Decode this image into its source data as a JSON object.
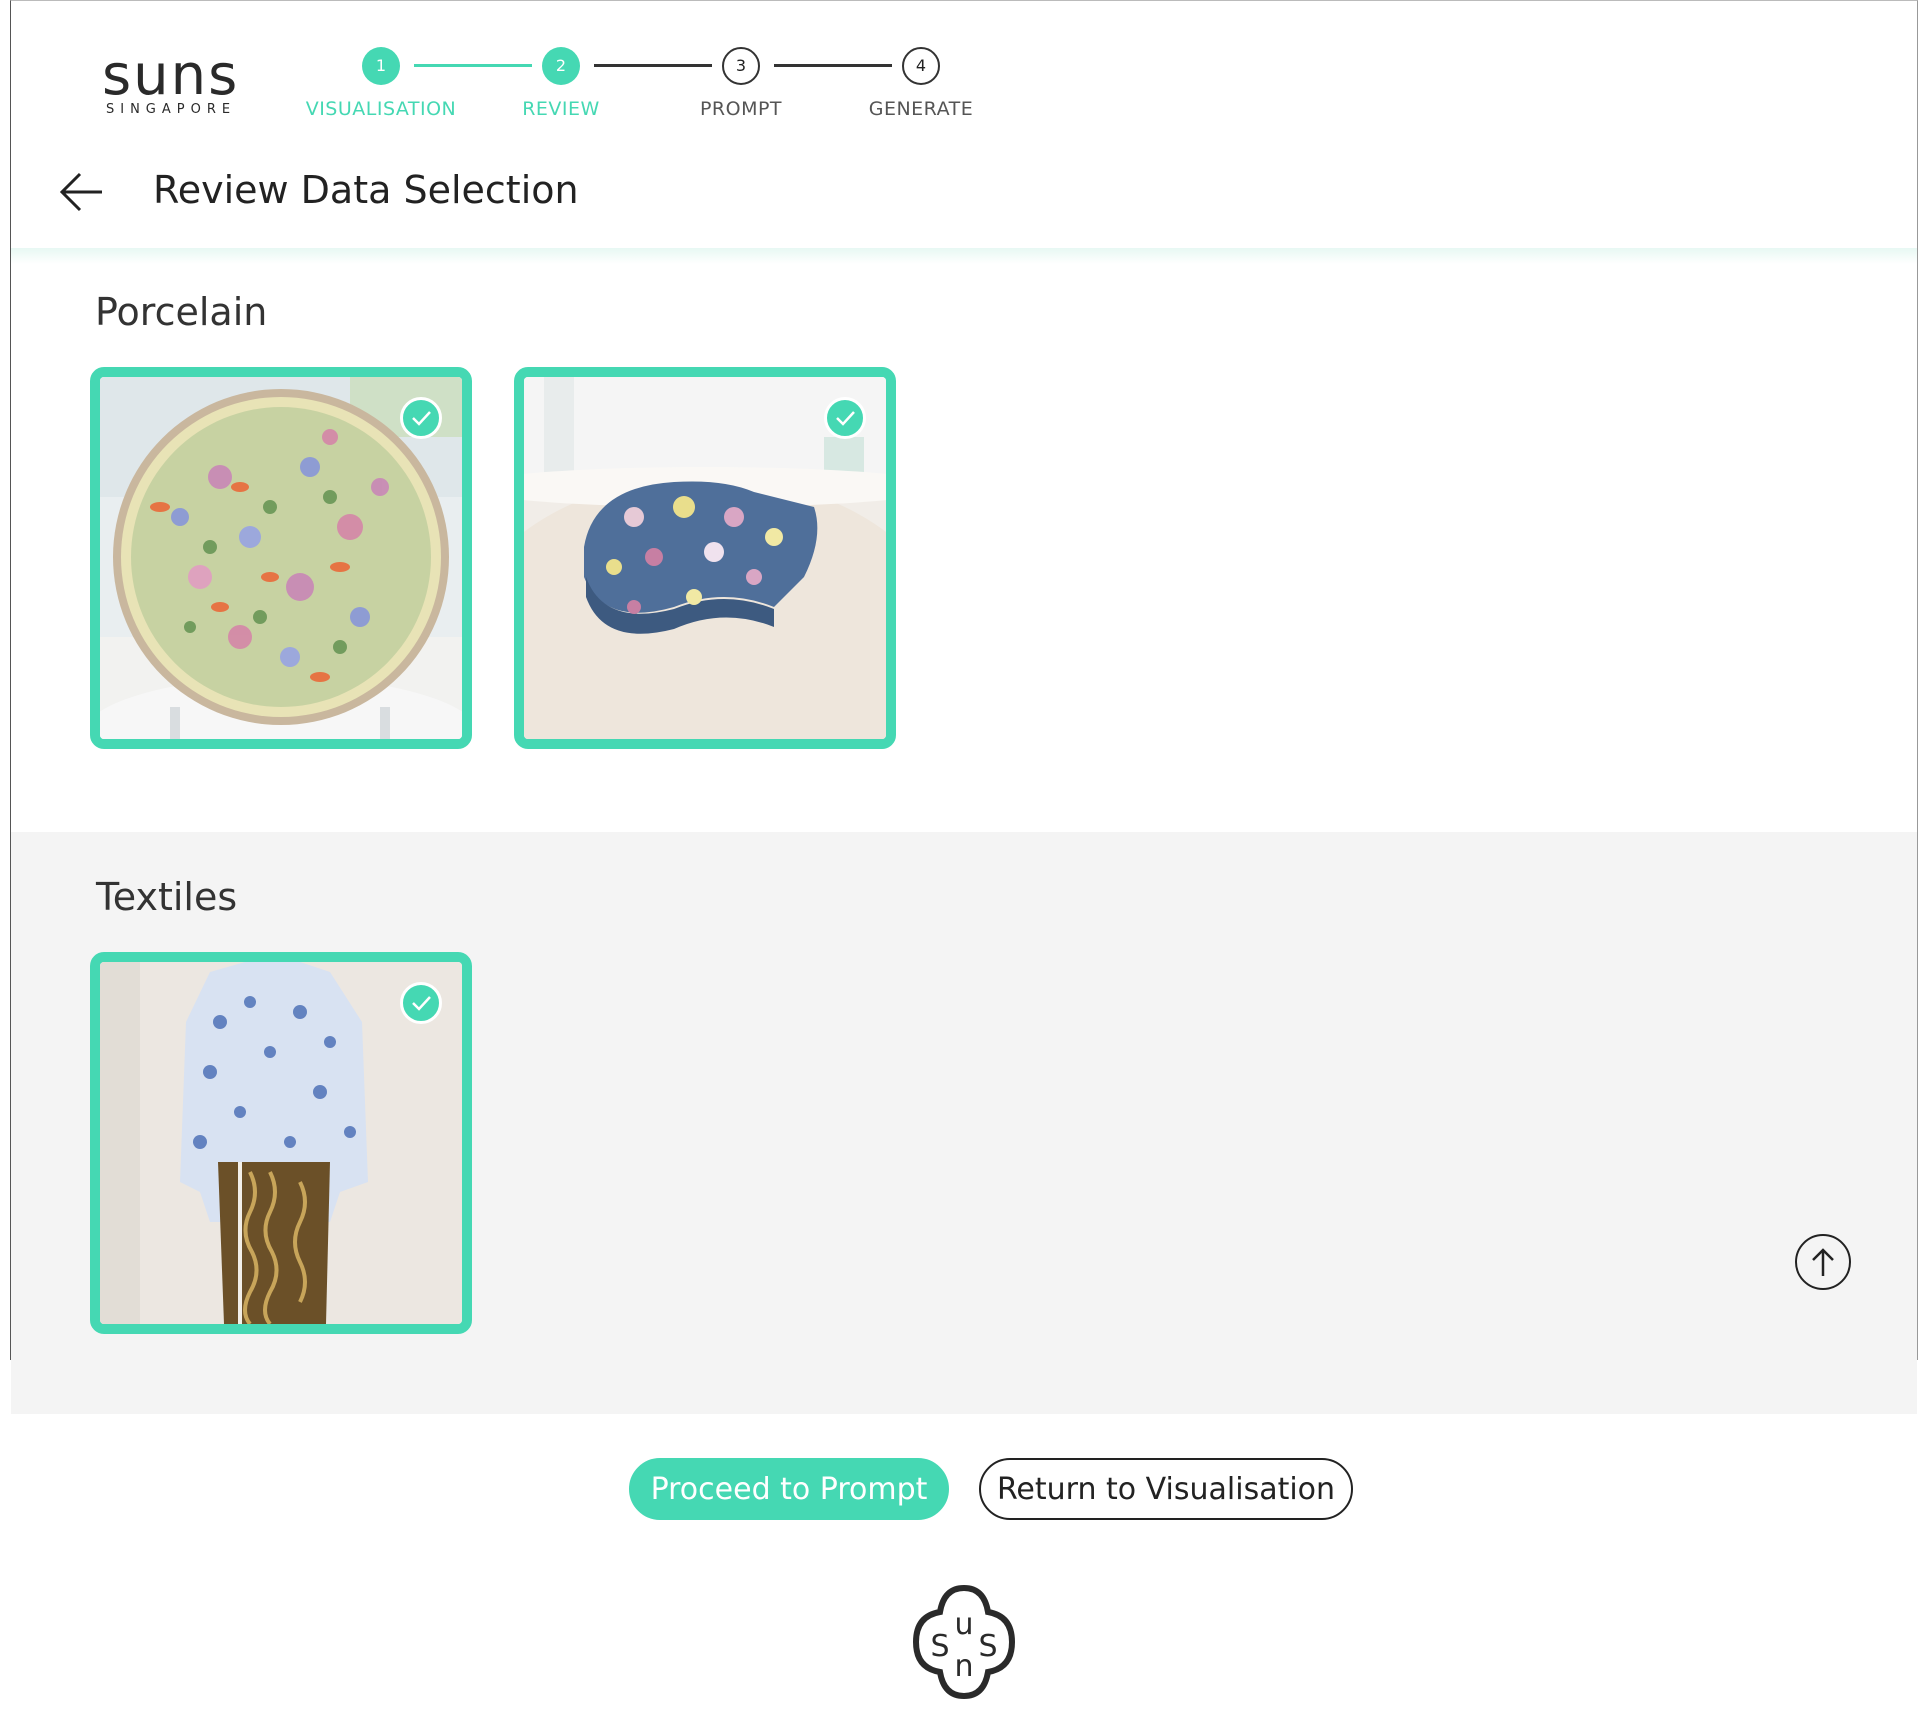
{
  "brand": {
    "name": "suns",
    "subtitle": "SINGAPORE",
    "footer_logo_letters": "suns"
  },
  "stepper": {
    "steps": [
      {
        "number": "1",
        "label": "VISUALISATION",
        "state": "done"
      },
      {
        "number": "2",
        "label": "REVIEW",
        "state": "current"
      },
      {
        "number": "3",
        "label": "PROMPT",
        "state": "todo"
      },
      {
        "number": "4",
        "label": "GENERATE",
        "state": "todo"
      }
    ]
  },
  "header": {
    "title": "Review Data Selection",
    "back_icon": "arrow-left-icon"
  },
  "sections": [
    {
      "title": "Porcelain",
      "items": [
        {
          "name": "floral-porcelain-plate",
          "selected": true
        },
        {
          "name": "floral-porcelain-box",
          "selected": true
        }
      ]
    },
    {
      "title": "Textiles",
      "items": [
        {
          "name": "blue-floral-kebaya-batik",
          "selected": true
        }
      ]
    }
  ],
  "actions": {
    "proceed_label": "Proceed to Prompt",
    "return_label": "Return to Visualisation"
  },
  "icons": {
    "check": "check-icon",
    "scroll_top": "arrow-up-circle-icon"
  },
  "colors": {
    "accent": "#45d8b3",
    "section_bg": "#f4f4f4",
    "text": "#222222"
  }
}
